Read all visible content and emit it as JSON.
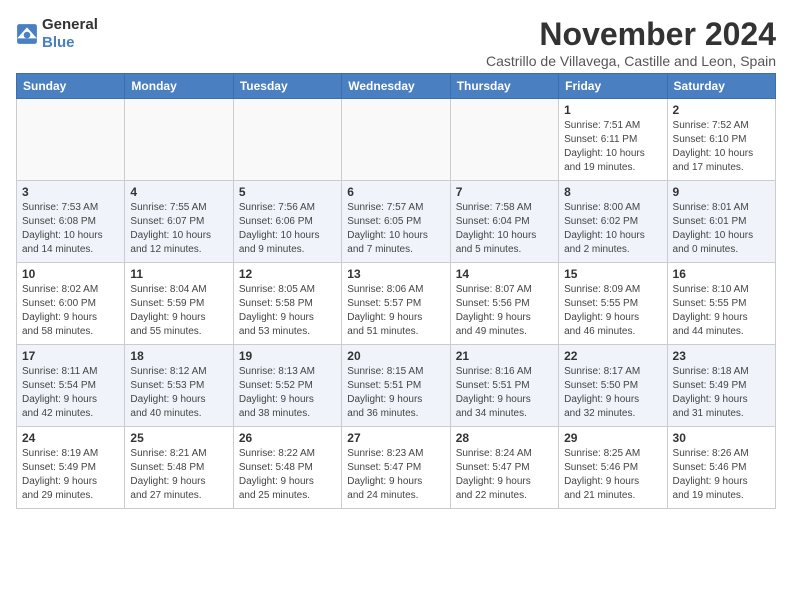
{
  "header": {
    "logo": {
      "general": "General",
      "blue": "Blue"
    },
    "month": "November 2024",
    "location": "Castrillo de Villavega, Castille and Leon, Spain"
  },
  "weekdays": [
    "Sunday",
    "Monday",
    "Tuesday",
    "Wednesday",
    "Thursday",
    "Friday",
    "Saturday"
  ],
  "weeks": [
    [
      {
        "day": "",
        "info": ""
      },
      {
        "day": "",
        "info": ""
      },
      {
        "day": "",
        "info": ""
      },
      {
        "day": "",
        "info": ""
      },
      {
        "day": "",
        "info": ""
      },
      {
        "day": "1",
        "info": "Sunrise: 7:51 AM\nSunset: 6:11 PM\nDaylight: 10 hours\nand 19 minutes."
      },
      {
        "day": "2",
        "info": "Sunrise: 7:52 AM\nSunset: 6:10 PM\nDaylight: 10 hours\nand 17 minutes."
      }
    ],
    [
      {
        "day": "3",
        "info": "Sunrise: 7:53 AM\nSunset: 6:08 PM\nDaylight: 10 hours\nand 14 minutes."
      },
      {
        "day": "4",
        "info": "Sunrise: 7:55 AM\nSunset: 6:07 PM\nDaylight: 10 hours\nand 12 minutes."
      },
      {
        "day": "5",
        "info": "Sunrise: 7:56 AM\nSunset: 6:06 PM\nDaylight: 10 hours\nand 9 minutes."
      },
      {
        "day": "6",
        "info": "Sunrise: 7:57 AM\nSunset: 6:05 PM\nDaylight: 10 hours\nand 7 minutes."
      },
      {
        "day": "7",
        "info": "Sunrise: 7:58 AM\nSunset: 6:04 PM\nDaylight: 10 hours\nand 5 minutes."
      },
      {
        "day": "8",
        "info": "Sunrise: 8:00 AM\nSunset: 6:02 PM\nDaylight: 10 hours\nand 2 minutes."
      },
      {
        "day": "9",
        "info": "Sunrise: 8:01 AM\nSunset: 6:01 PM\nDaylight: 10 hours\nand 0 minutes."
      }
    ],
    [
      {
        "day": "10",
        "info": "Sunrise: 8:02 AM\nSunset: 6:00 PM\nDaylight: 9 hours\nand 58 minutes."
      },
      {
        "day": "11",
        "info": "Sunrise: 8:04 AM\nSunset: 5:59 PM\nDaylight: 9 hours\nand 55 minutes."
      },
      {
        "day": "12",
        "info": "Sunrise: 8:05 AM\nSunset: 5:58 PM\nDaylight: 9 hours\nand 53 minutes."
      },
      {
        "day": "13",
        "info": "Sunrise: 8:06 AM\nSunset: 5:57 PM\nDaylight: 9 hours\nand 51 minutes."
      },
      {
        "day": "14",
        "info": "Sunrise: 8:07 AM\nSunset: 5:56 PM\nDaylight: 9 hours\nand 49 minutes."
      },
      {
        "day": "15",
        "info": "Sunrise: 8:09 AM\nSunset: 5:55 PM\nDaylight: 9 hours\nand 46 minutes."
      },
      {
        "day": "16",
        "info": "Sunrise: 8:10 AM\nSunset: 5:55 PM\nDaylight: 9 hours\nand 44 minutes."
      }
    ],
    [
      {
        "day": "17",
        "info": "Sunrise: 8:11 AM\nSunset: 5:54 PM\nDaylight: 9 hours\nand 42 minutes."
      },
      {
        "day": "18",
        "info": "Sunrise: 8:12 AM\nSunset: 5:53 PM\nDaylight: 9 hours\nand 40 minutes."
      },
      {
        "day": "19",
        "info": "Sunrise: 8:13 AM\nSunset: 5:52 PM\nDaylight: 9 hours\nand 38 minutes."
      },
      {
        "day": "20",
        "info": "Sunrise: 8:15 AM\nSunset: 5:51 PM\nDaylight: 9 hours\nand 36 minutes."
      },
      {
        "day": "21",
        "info": "Sunrise: 8:16 AM\nSunset: 5:51 PM\nDaylight: 9 hours\nand 34 minutes."
      },
      {
        "day": "22",
        "info": "Sunrise: 8:17 AM\nSunset: 5:50 PM\nDaylight: 9 hours\nand 32 minutes."
      },
      {
        "day": "23",
        "info": "Sunrise: 8:18 AM\nSunset: 5:49 PM\nDaylight: 9 hours\nand 31 minutes."
      }
    ],
    [
      {
        "day": "24",
        "info": "Sunrise: 8:19 AM\nSunset: 5:49 PM\nDaylight: 9 hours\nand 29 minutes."
      },
      {
        "day": "25",
        "info": "Sunrise: 8:21 AM\nSunset: 5:48 PM\nDaylight: 9 hours\nand 27 minutes."
      },
      {
        "day": "26",
        "info": "Sunrise: 8:22 AM\nSunset: 5:48 PM\nDaylight: 9 hours\nand 25 minutes."
      },
      {
        "day": "27",
        "info": "Sunrise: 8:23 AM\nSunset: 5:47 PM\nDaylight: 9 hours\nand 24 minutes."
      },
      {
        "day": "28",
        "info": "Sunrise: 8:24 AM\nSunset: 5:47 PM\nDaylight: 9 hours\nand 22 minutes."
      },
      {
        "day": "29",
        "info": "Sunrise: 8:25 AM\nSunset: 5:46 PM\nDaylight: 9 hours\nand 21 minutes."
      },
      {
        "day": "30",
        "info": "Sunrise: 8:26 AM\nSunset: 5:46 PM\nDaylight: 9 hours\nand 19 minutes."
      }
    ]
  ]
}
